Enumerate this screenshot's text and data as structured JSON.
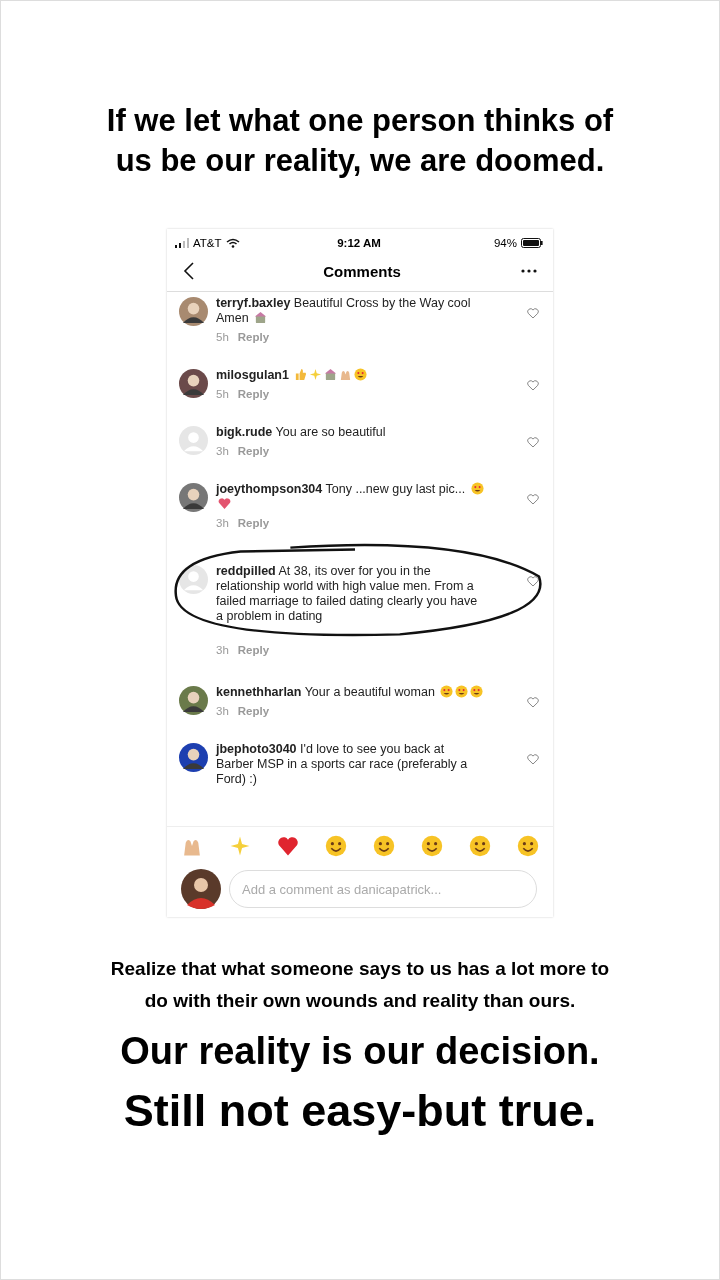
{
  "headline": [
    "If we let what one person thinks of",
    "us be our reality, we are doomed."
  ],
  "screenshot": {
    "status_bar": {
      "carrier": "AT&T",
      "time": "9:12 AM",
      "battery": "94%"
    },
    "nav": {
      "title": "Comments"
    },
    "comments": [
      {
        "user": "terryf.baxley",
        "text": "Beautiful Cross by the Way cool Amen",
        "emojis": [
          {
            "kind": "object"
          }
        ],
        "time": "5h",
        "reply": "Reply",
        "avatar": {
          "kind": "photo",
          "color": "#a88a70"
        },
        "highlighted": false
      },
      {
        "user": "milosgulan1",
        "emojis": [
          {
            "kind": "thumbs"
          },
          {
            "kind": "sparkles"
          },
          {
            "kind": "object"
          },
          {
            "kind": "hands"
          },
          {
            "kind": "face"
          }
        ],
        "time": "5h",
        "reply": "Reply",
        "avatar": {
          "kind": "photo",
          "color": "#6b4a4a"
        },
        "highlighted": false
      },
      {
        "user": "bigk.rude",
        "text": "You are so beautiful",
        "time": "3h",
        "reply": "Reply",
        "avatar": {
          "kind": "default",
          "color": "#e6e6e6"
        },
        "highlighted": false
      },
      {
        "user": "joeythompson304",
        "text": "Tony ...new guy last pic...",
        "emojis": [
          {
            "kind": "face"
          },
          {
            "kind": "heart"
          }
        ],
        "time": "3h",
        "reply": "Reply",
        "avatar": {
          "kind": "photo",
          "color": "#777777"
        },
        "highlighted": false
      },
      {
        "user": "reddpilled",
        "text": "At 38, its over for you in the relationship world with high value men. From a failed marriage to failed dating clearly you have a problem in dating",
        "time": "3h",
        "reply": "Reply",
        "avatar": {
          "kind": "default",
          "color": "#e6e6e6"
        },
        "highlighted": true
      },
      {
        "user": "kennethharlan",
        "text": "Your a beautiful woman",
        "emojis": [
          {
            "kind": "face"
          },
          {
            "kind": "face"
          },
          {
            "kind": "face"
          }
        ],
        "time": "3h",
        "reply": "Reply",
        "avatar": {
          "kind": "photo",
          "color": "#6a7a4a"
        },
        "highlighted": false
      },
      {
        "user": "jbephoto3040",
        "text": "I'd love to see you back at Barber MSP in a sports car race (preferably a Ford) :)",
        "avatar": {
          "kind": "photo",
          "color": "#1d3fb0"
        },
        "highlighted": false
      }
    ],
    "quick_emojis": [
      {
        "kind": "hands"
      },
      {
        "kind": "sparkles"
      },
      {
        "kind": "heart"
      },
      {
        "kind": "face"
      },
      {
        "kind": "face"
      },
      {
        "kind": "face"
      },
      {
        "kind": "face"
      },
      {
        "kind": "face"
      }
    ],
    "composer": {
      "placeholder": "Add a comment as danicapatrick..."
    }
  },
  "caption": [
    "Realize that what someone says to us has a lot more to",
    "do with their own wounds and reality than ours."
  ],
  "statements": [
    "Our reality is our decision.",
    "Still not easy-but true."
  ]
}
